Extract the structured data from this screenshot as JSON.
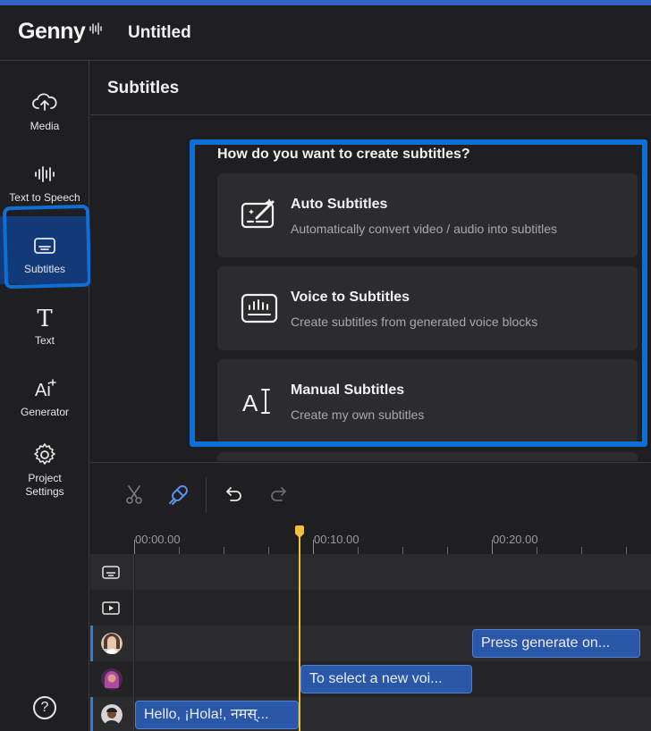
{
  "app": {
    "name": "Genny",
    "document_title": "Untitled"
  },
  "sidebar": {
    "items": [
      {
        "id": "media",
        "label": "Media",
        "icon": "upload-cloud-icon"
      },
      {
        "id": "tts",
        "label": "Text to Speech",
        "icon": "waveform-icon"
      },
      {
        "id": "subtitles",
        "label": "Subtitles",
        "icon": "subtitles-icon",
        "active": true
      },
      {
        "id": "text",
        "label": "Text",
        "icon": "text-t-icon"
      },
      {
        "id": "generator",
        "label": "Generator",
        "icon": "ai-sparkle-icon"
      },
      {
        "id": "project-settings",
        "label": "Project Settings",
        "icon": "gear-icon"
      }
    ],
    "help_label": "?"
  },
  "panel": {
    "title": "Subtitles",
    "question": "How do you want to create subtitles?",
    "options": [
      {
        "title": "Auto Subtitles",
        "description": "Automatically convert video / audio into subtitles",
        "icon": "magic-subtitles-icon"
      },
      {
        "title": "Voice to Subtitles",
        "description": "Create subtitles from generated voice blocks",
        "icon": "voice-bars-icon"
      },
      {
        "title": "Manual Subtitles",
        "description": "Create my own subtitles",
        "icon": "text-cursor-icon"
      }
    ]
  },
  "timeline": {
    "tools": [
      "scissors-icon",
      "magnet-icon",
      "undo-icon",
      "redo-icon"
    ],
    "ruler_labels": [
      "00:00.00",
      "00:10.00",
      "00:20.00"
    ],
    "clips": {
      "row3": "Press generate on...",
      "row4": "To select a new voi...",
      "row5": "Hello, ¡Hola!, नमस्..."
    }
  },
  "colors": {
    "accent": "#0f6fd6",
    "clip": "#2b57a8",
    "playhead": "#f0c23c",
    "background": "#1f1f21"
  }
}
